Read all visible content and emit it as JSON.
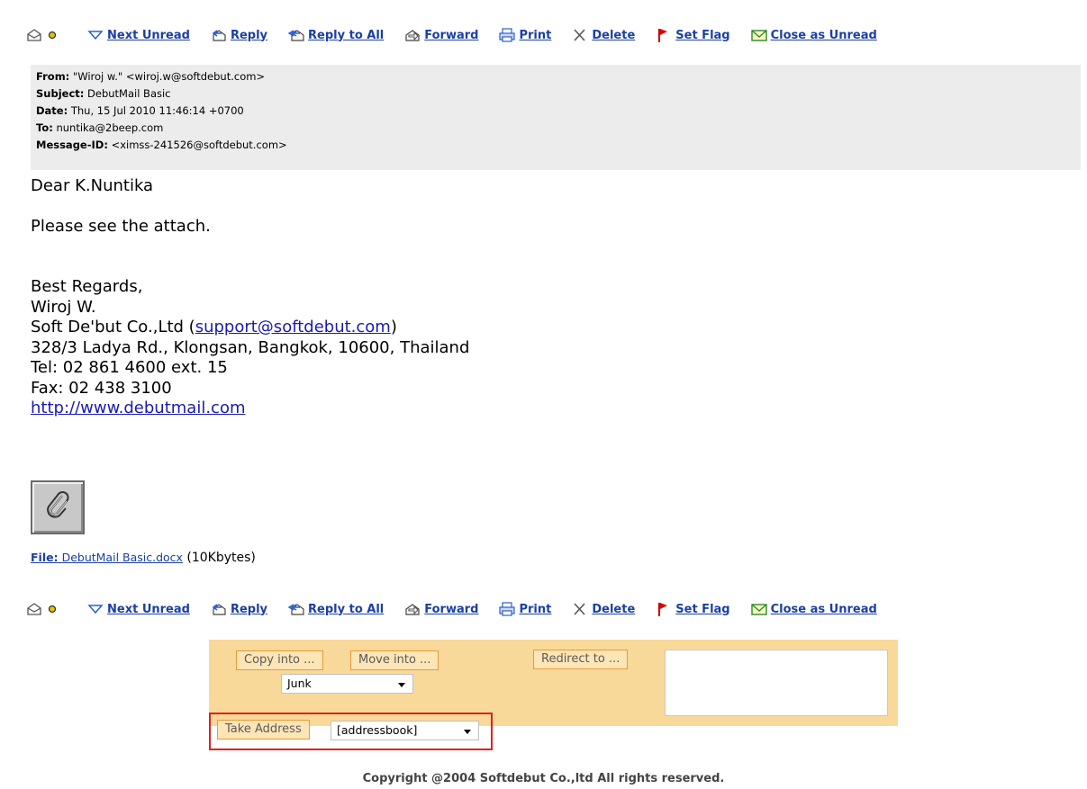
{
  "toolbar": {
    "next_unread": "Next Unread",
    "reply": "Reply",
    "reply_all": "Reply to All",
    "forward": "Forward",
    "print": "Print",
    "delete": "Delete",
    "set_flag": "Set Flag",
    "close_unread": "Close as Unread"
  },
  "headers": {
    "from_label": "From:",
    "from_value": "\"Wiroj w.\" <wiroj.w@softdebut.com>",
    "subject_label": "Subject:",
    "subject_value": "DebutMail Basic",
    "date_label": "Date:",
    "date_value": "Thu, 15 Jul 2010 11:46:14 +0700",
    "to_label": "To:",
    "to_value": "nuntika@2beep.com",
    "msgid_label": "Message-ID:",
    "msgid_value": "<ximss-241526@softdebut.com>"
  },
  "body": {
    "greeting": "Dear K.Nuntika",
    "line1": "Please see the attach.",
    "regards": "Best Regards,",
    "name": "Wiroj W.",
    "company": "Soft De'but Co.,Ltd (",
    "company_email": "support@softdebut.com",
    "company_close": ")",
    "address": "328/3 Ladya Rd., Klongsan, Bangkok, 10600, Thailand",
    "tel": "Tel: 02 861 4600 ext. 15",
    "fax": "Fax: 02 438 3100",
    "website": "http://www.debutmail.com"
  },
  "attachment": {
    "file_label": "File:",
    "file_name": "DebutMail Basic.docx",
    "size": "(10Kbytes)"
  },
  "actions": {
    "copy_into": "Copy into ...",
    "move_into": "Move into ...",
    "redirect_to": "Redirect to ...",
    "folder_selected": "Junk",
    "take_address": "Take Address",
    "addressbook_selected": "[addressbook]"
  },
  "footer": {
    "copyright": "Copyright @2004 Softdebut Co.,ltd All rights reserved."
  }
}
